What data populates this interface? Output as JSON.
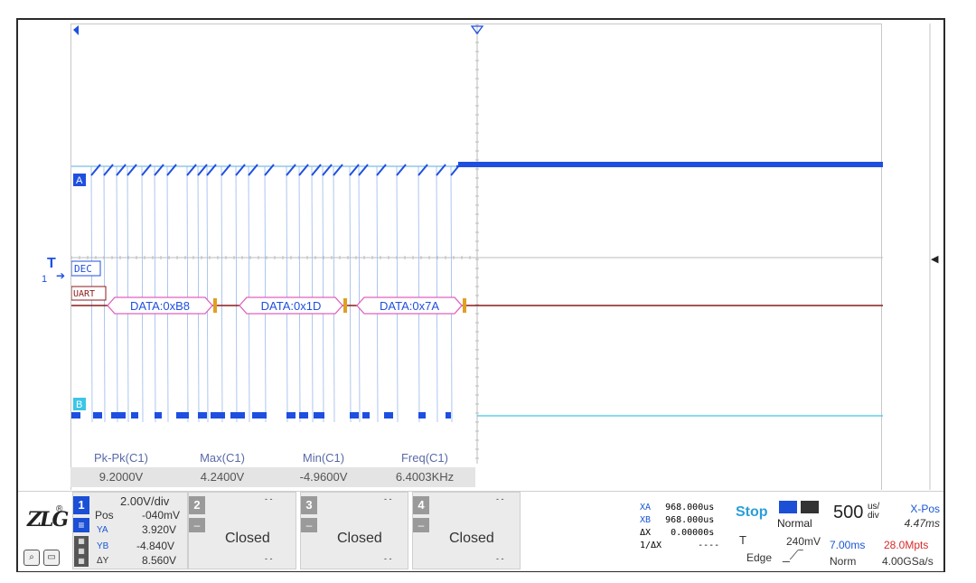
{
  "markers": {
    "channel_a": "A",
    "channel_b": "B",
    "trigger": "T",
    "trigger_sub": "1",
    "dec": "DEC",
    "uart": "UART"
  },
  "decode": [
    {
      "label": "DATA:0xB8"
    },
    {
      "label": "DATA:0x1D"
    },
    {
      "label": "DATA:0x7A"
    }
  ],
  "measurements": {
    "headers": [
      "Pk-Pk(C1)",
      "Max(C1)",
      "Min(C1)",
      "Freq(C1)"
    ],
    "values": [
      "9.2000V",
      "4.2400V",
      "-4.9600V",
      "6.4003KHz"
    ]
  },
  "channel1": {
    "number": "1",
    "scale": "2.00V/div",
    "pos_label": "Pos",
    "pos_value": "-040mV",
    "ya_label": "YA",
    "ya_value": "3.920V",
    "yb_label": "YB",
    "yb_value": "-4.840V",
    "dy_label": "ΔY",
    "dy_value": "8.560V"
  },
  "channels_closed": [
    {
      "number": "2",
      "state": "Closed",
      "dash_top": "- -",
      "dash_bottom": "- -"
    },
    {
      "number": "3",
      "state": "Closed",
      "dash_top": "- -",
      "dash_bottom": "- -"
    },
    {
      "number": "4",
      "state": "Closed",
      "dash_top": "- -",
      "dash_bottom": "- -"
    }
  ],
  "cursors": {
    "xa_label": "XA",
    "xa_value": "968.000us",
    "xb_label": "XB",
    "xb_value": "968.000us",
    "dx_label": "ΔX",
    "dx_value": "0.00000s",
    "inv_label": "1/ΔX",
    "inv_value": "----"
  },
  "acquisition": {
    "run_state": "Stop",
    "mode": "Normal",
    "trigger_label": "T",
    "trigger_level": "240mV",
    "trigger_type": "Edge"
  },
  "timebase": {
    "value": "500",
    "unit_top": "us/",
    "unit_bottom": "div",
    "xpos_label": "X-Pos",
    "xpos_value": "4.47ms",
    "memory": "7.00ms",
    "rate": "28.0Mpts",
    "mode": "Norm",
    "sample_rate": "4.00GSa/s"
  },
  "brand": {
    "logo": "ZLG"
  },
  "colors": {
    "channel_a": "#1f4fe0",
    "channel_b": "#1f4fe0",
    "trace_b_line": "#3cc6e6",
    "trace_a_line": "#5aaee0",
    "decode_line": "#8b1a1a",
    "decode_box": "#e060c0",
    "cursor_blue": "#1a56d6",
    "stop_color": "#2a9fd8",
    "rate_color": "#d62a2a"
  }
}
